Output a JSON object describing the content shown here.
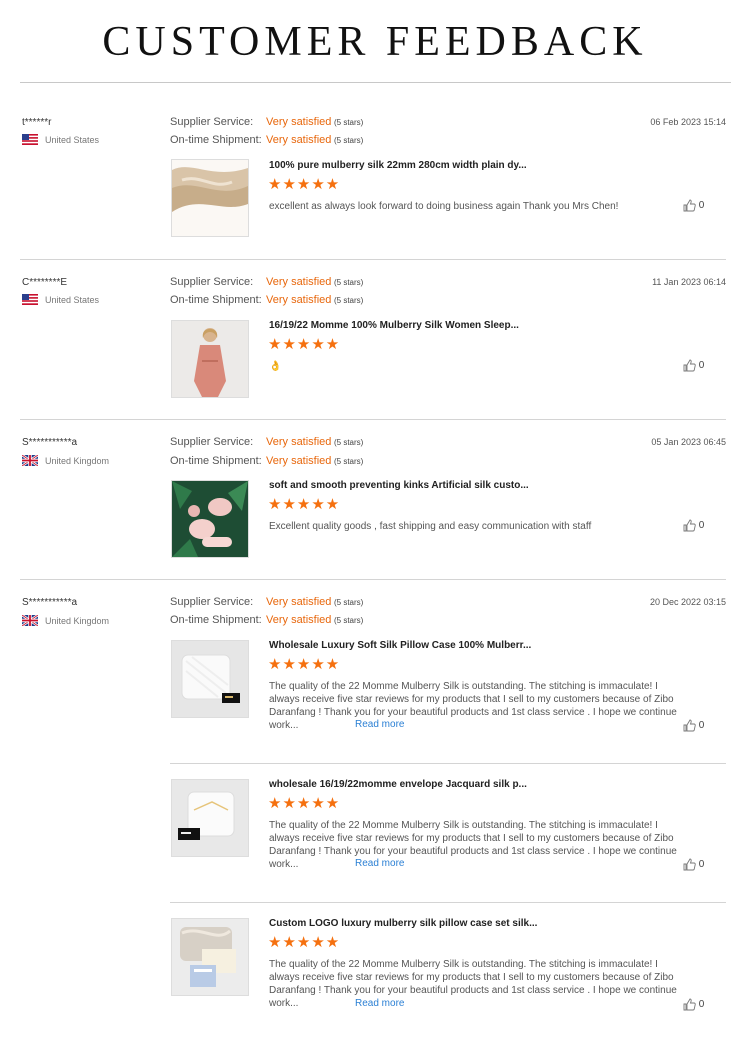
{
  "page": {
    "title": "CUSTOMER FEEDBACK"
  },
  "labels": {
    "supplier_service": "Supplier Service:",
    "ontime_shipment": "On-time Shipment:",
    "read_more": "Read more"
  },
  "colors": {
    "accent": "#e8670c",
    "stars": "#f5700f",
    "link": "#2a7fd4"
  },
  "reviews": [
    {
      "user": "t******r",
      "country": "United States",
      "flag_icon": "us-flag-icon",
      "date": "06 Feb 2023 15:14",
      "supplier_rating": "Very satisfied",
      "supplier_stars": "(5 stars)",
      "shipment_rating": "Very satisfied",
      "shipment_stars": "(5 stars)",
      "products": [
        {
          "title": "100% pure mulberry silk 22mm 280cm width plain dy...",
          "stars": "★★★★★",
          "rating": 5,
          "comment": "excellent as always look forward to doing business again  Thank you Mrs Chen!",
          "likes": "0",
          "thumb": "silk-fabric-thumbnail"
        }
      ]
    },
    {
      "user": "C********E",
      "country": "United States",
      "flag_icon": "us-flag-icon",
      "date": "11 Jan 2023 06:14",
      "supplier_rating": "Very satisfied",
      "supplier_stars": "(5 stars)",
      "shipment_rating": "Very satisfied",
      "shipment_stars": "(5 stars)",
      "products": [
        {
          "title": "16/19/22 Momme 100% Mulberry Silk Women Sleep...",
          "stars": "★★★★★",
          "rating": 5,
          "comment": "👌",
          "likes": "0",
          "thumb": "silk-robe-thumbnail"
        }
      ]
    },
    {
      "user": "S***********a",
      "country": "United Kingdom",
      "flag_icon": "uk-flag-icon",
      "date": "05 Jan 2023 06:45",
      "supplier_rating": "Very satisfied",
      "supplier_stars": "(5 stars)",
      "shipment_rating": "Very satisfied",
      "shipment_stars": "(5 stars)",
      "products": [
        {
          "title": "soft and smooth preventing kinks Artificial silk custo...",
          "stars": "★★★★★",
          "rating": 5,
          "comment": "Excellent quality goods , fast shipping and easy communication with staff",
          "likes": "0",
          "thumb": "silk-scrunchie-set-thumbnail"
        }
      ]
    },
    {
      "user": "S***********a",
      "country": "United Kingdom",
      "flag_icon": "uk-flag-icon",
      "date": "20 Dec 2022 03:15",
      "supplier_rating": "Very satisfied",
      "supplier_stars": "(5 stars)",
      "shipment_rating": "Very satisfied",
      "shipment_stars": "(5 stars)",
      "products": [
        {
          "title": "Wholesale Luxury Soft Silk Pillow Case 100% Mulberr...",
          "stars": "★★★★★",
          "rating": 5,
          "comment": "The quality of the 22 Momme Mulberry Silk is outstanding. The stitching is immaculate! I always receive five star reviews for my products that I sell to my customers because of Zibo Daranfang ! Thank you for your beautiful products and 1st class  service . I hope we continue work...",
          "likes": "0",
          "thumb": "white-pillowcase-thumbnail"
        },
        {
          "title": "wholesale 16/19/22momme envelope Jacquard silk p...",
          "stars": "★★★★★",
          "rating": 5,
          "comment": "The quality of the 22 Momme Mulberry Silk is outstanding. The stitching is immaculate! I always receive five star reviews for my products that I sell to my customers because of Zibo Daranfang ! Thank you for your beautiful products and 1st class  service . I hope we continue work...",
          "likes": "0",
          "thumb": "jacquard-pillowcase-thumbnail"
        },
        {
          "title": "Custom LOGO luxury mulberry silk pillow case set silk...",
          "stars": "★★★★★",
          "rating": 5,
          "comment": "The quality of the 22 Momme Mulberry Silk is outstanding. The stitching is immaculate! I always receive five star reviews for my products that I sell to my customers because of Zibo Daranfang ! Thank you for your beautiful products and 1st class  service . I hope we continue work...",
          "likes": "0",
          "thumb": "pillowcase-set-thumbnail"
        }
      ]
    }
  ]
}
